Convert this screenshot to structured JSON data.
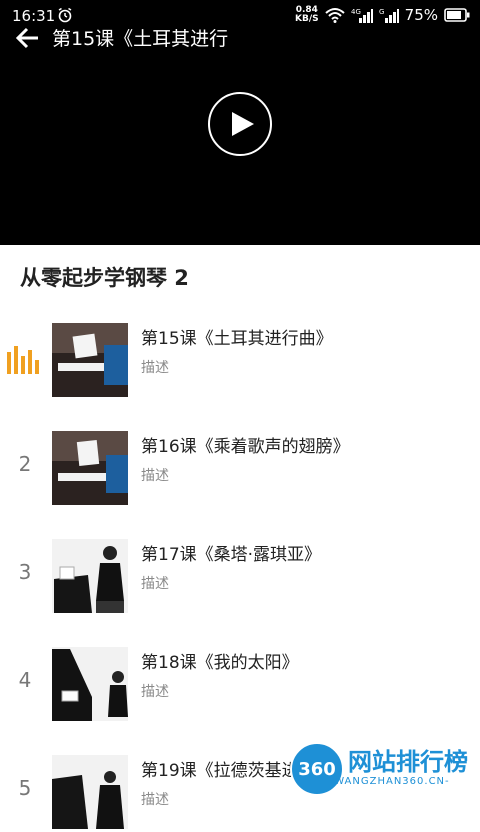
{
  "status_bar": {
    "time": "16:31",
    "speed_value": "0.84",
    "speed_unit": "KB/S",
    "network_4g": "4G",
    "network_g": "G",
    "battery": "75%"
  },
  "player": {
    "title": "第15课《土耳其进行"
  },
  "course": {
    "title": "从零起步学钢琴 2"
  },
  "lessons": [
    {
      "index": "",
      "name": "第15课《土耳其进行曲》",
      "desc": "描述",
      "playing": true
    },
    {
      "index": "2",
      "name": "第16课《乘着歌声的翅膀》",
      "desc": "描述",
      "playing": false
    },
    {
      "index": "3",
      "name": "第17课《桑塔·露琪亚》",
      "desc": "描述",
      "playing": false
    },
    {
      "index": "4",
      "name": "第18课《我的太阳》",
      "desc": "描述",
      "playing": false
    },
    {
      "index": "5",
      "name": "第19课《拉德茨基进行曲》",
      "desc": "描述",
      "playing": false
    }
  ],
  "watermark": {
    "badge": "360",
    "name": "网站排行榜",
    "url": "-WANGZHAN360.CN-"
  },
  "colors": {
    "accent_playing": "#f0a020",
    "watermark_blue": "#1e90d6"
  }
}
